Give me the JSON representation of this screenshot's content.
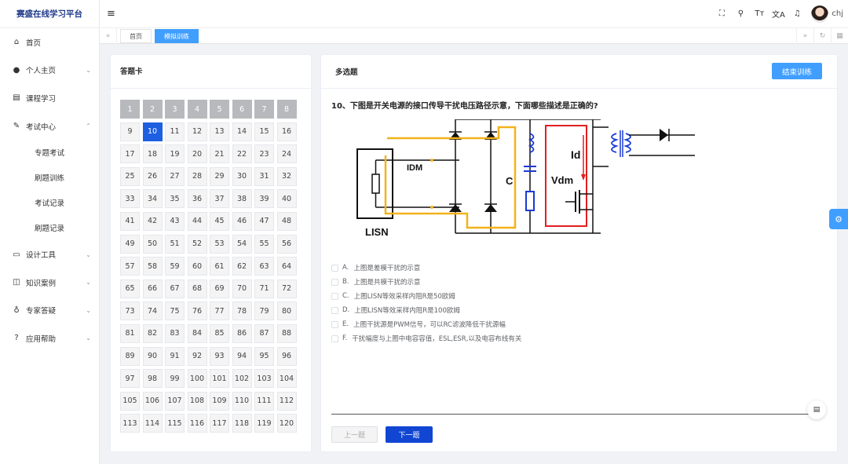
{
  "app": {
    "title": "赛盛在线学习平台"
  },
  "sidebar": {
    "items": [
      {
        "label": "首页",
        "icon": "home-icon",
        "glyph": "⌂",
        "expandable": false
      },
      {
        "label": "个人主页",
        "icon": "user-icon",
        "glyph": "●",
        "expandable": true,
        "chevron": "⌄"
      },
      {
        "label": "课程学习",
        "icon": "book-icon",
        "glyph": "▤",
        "expandable": false
      },
      {
        "label": "考试中心",
        "icon": "edit-icon",
        "glyph": "✎",
        "expandable": true,
        "chevron": "⌃",
        "children": [
          "专题考试",
          "刷题训练",
          "考试记录",
          "刷题记录"
        ]
      },
      {
        "label": "设计工具",
        "icon": "briefcase-icon",
        "glyph": "▭",
        "expandable": true,
        "chevron": "⌄"
      },
      {
        "label": "知识案例",
        "icon": "book-open-icon",
        "glyph": "◫",
        "expandable": true,
        "chevron": "⌄"
      },
      {
        "label": "专家答疑",
        "icon": "expert-icon",
        "glyph": "♁",
        "expandable": true,
        "chevron": "⌄"
      },
      {
        "label": "应用帮助",
        "icon": "help-icon",
        "glyph": "?",
        "expandable": true,
        "chevron": "⌄"
      }
    ]
  },
  "header": {
    "menu_glyph": "≡",
    "icons": [
      {
        "name": "fullscreen-icon",
        "glyph": "⛶"
      },
      {
        "name": "search-icon",
        "glyph": "⚲"
      },
      {
        "name": "font-size-icon",
        "glyph": "Tт"
      },
      {
        "name": "translate-icon",
        "glyph": "文A"
      },
      {
        "name": "bell-icon",
        "glyph": "♫"
      }
    ],
    "username": "chj"
  },
  "tabs": {
    "left_arrow": "«",
    "items": [
      {
        "label": "首页",
        "active": false
      },
      {
        "label": "模拟训练",
        "active": true
      }
    ],
    "right_arrow": "»",
    "refresh": "↻",
    "grid": "▦"
  },
  "answer_card": {
    "title": "答题卡",
    "total": 120,
    "answered": [
      1,
      2,
      3,
      4,
      5,
      6,
      7,
      8
    ],
    "current": 10
  },
  "question": {
    "type_label": "多选题",
    "end_button": "结束训练",
    "text": "10、下图是开关电源的接口传导干扰电压路径示意，下面哪些描述是正确的?",
    "diagram_labels": {
      "lisn": "LISN",
      "idm": "IDM",
      "c": "C",
      "id": "Id",
      "vdm": "Vdm"
    },
    "options": [
      {
        "letter": "A.",
        "text": "上图是差模干扰的示意"
      },
      {
        "letter": "B.",
        "text": "上图是共模干扰的示意"
      },
      {
        "letter": "C.",
        "text": "上图LISN等效采样内阻R是50欧姆"
      },
      {
        "letter": "D.",
        "text": "上图LISN等效采样内阻R是100欧姆"
      },
      {
        "letter": "E.",
        "text": "上图干扰源是PWM信号，可以RC滤波降低干扰源幅"
      },
      {
        "letter": "F.",
        "text": "干扰幅度与上图中电容容值，ESL,ESR,以及电容布线有关"
      }
    ],
    "prev_button": "上一题",
    "next_button": "下一题",
    "feedback_glyph": "▤"
  },
  "floating": {
    "settings_glyph": "⚙"
  },
  "colors": {
    "primary": "#409eff",
    "next_button": "#1146d3",
    "current_number": "#1d5fe0",
    "answered_number": "#b7b9bd"
  }
}
